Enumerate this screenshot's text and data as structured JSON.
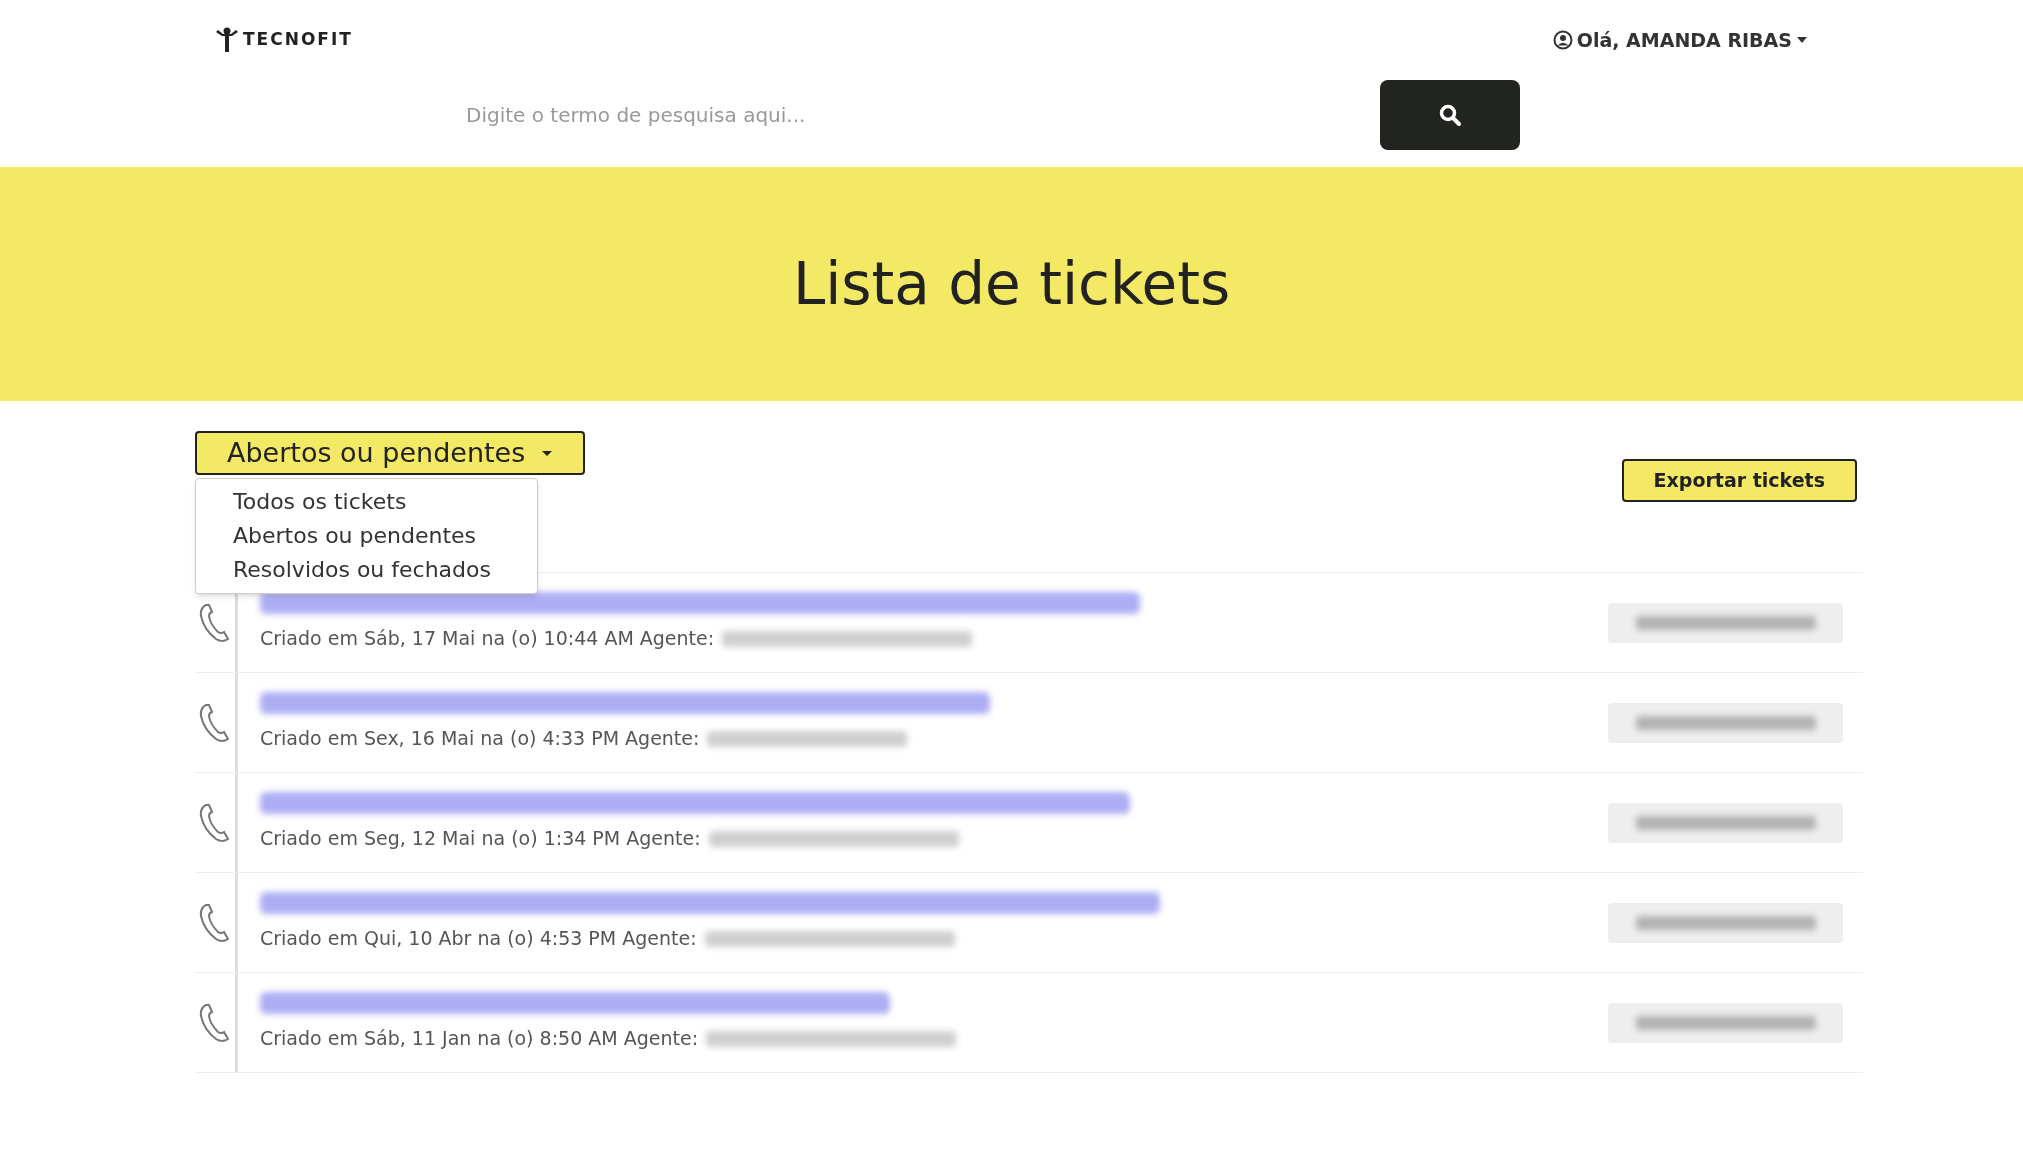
{
  "header": {
    "logo": "TECNOFIT",
    "user_menu": "Olá, AMANDA RIBAS"
  },
  "search": {
    "placeholder": "Digite o termo de pesquisa aqui..."
  },
  "banner": {
    "title": "Lista de tickets"
  },
  "filter": {
    "label": "Abertos ou pendentes",
    "expanded": true,
    "options": [
      {
        "label": "Todos os tickets"
      },
      {
        "label": "Abertos ou pendentes"
      },
      {
        "label": "Resolvidos ou fechados"
      }
    ]
  },
  "export_button": "Exportar tickets",
  "tickets": [
    {
      "created": "Criado em Sáb, 17 Mai na (o) 10:44 AM Agente:"
    },
    {
      "created": "Criado em Sex, 16 Mai na (o) 4:33 PM Agente:"
    },
    {
      "created": "Criado em Seg, 12 Mai na (o) 1:34 PM Agente:"
    },
    {
      "created": "Criado em Qui, 10 Abr na (o) 4:53 PM Agente:"
    },
    {
      "created": "Criado em Sáb, 11 Jan na (o) 8:50 AM Agente:"
    }
  ]
}
